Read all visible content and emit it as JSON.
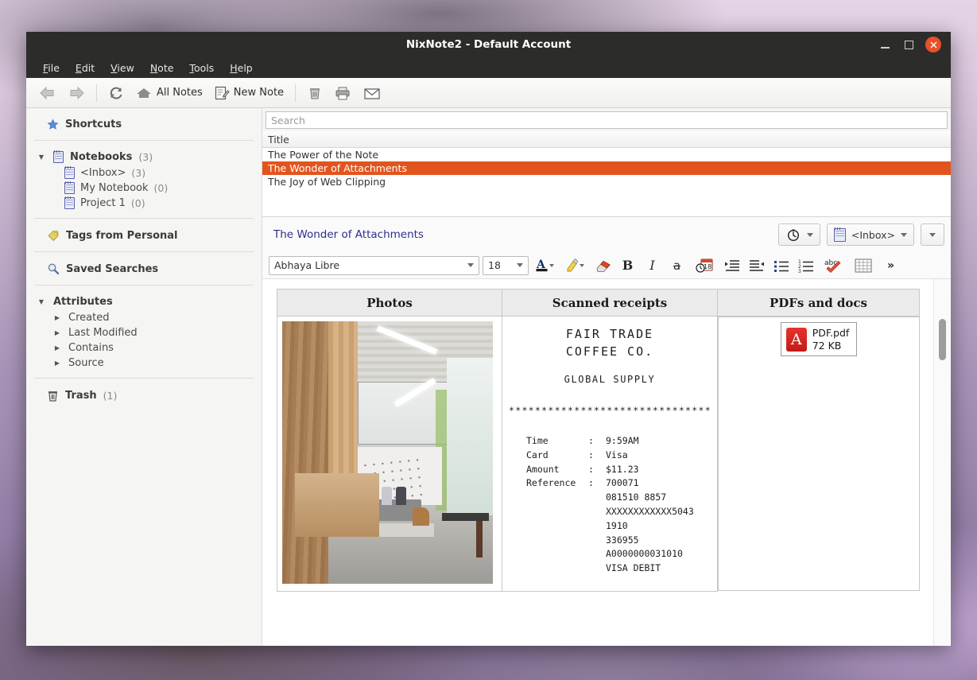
{
  "window": {
    "title": "NixNote2 - Default Account",
    "controls": {
      "minimize": "—",
      "maximize": "□",
      "close": "✕"
    },
    "close_color": "#e8502a"
  },
  "menubar": [
    {
      "label": "File",
      "accel": "F"
    },
    {
      "label": "Edit",
      "accel": "E"
    },
    {
      "label": "View",
      "accel": "V"
    },
    {
      "label": "Note",
      "accel": "N"
    },
    {
      "label": "Tools",
      "accel": "T"
    },
    {
      "label": "Help",
      "accel": "H"
    }
  ],
  "toolbar": {
    "back": "back-arrow",
    "forward": "forward-arrow",
    "sync": "sync-icon",
    "all_notes_label": "All Notes",
    "new_note_label": "New Note",
    "trash": "trash-icon",
    "print": "printer-icon",
    "email": "envelope-icon"
  },
  "sidebar": {
    "shortcuts": {
      "label": "Shortcuts",
      "icon": "star-icon"
    },
    "notebooks": {
      "label": "Notebooks",
      "count": "(3)",
      "icon": "notebook-icon",
      "items": [
        {
          "label": "<Inbox>",
          "count": "(3)"
        },
        {
          "label": "My Notebook",
          "count": "(0)"
        },
        {
          "label": "Project 1",
          "count": "(0)"
        }
      ]
    },
    "tags": {
      "label": "Tags from Personal",
      "icon": "tag-icon"
    },
    "saved_searches": {
      "label": "Saved Searches",
      "icon": "magnifier-icon"
    },
    "attributes": {
      "label": "Attributes",
      "items": [
        {
          "label": "Created"
        },
        {
          "label": "Last Modified"
        },
        {
          "label": "Contains"
        },
        {
          "label": "Source"
        }
      ]
    },
    "trash": {
      "label": "Trash",
      "count": "(1)",
      "icon": "trash-icon"
    }
  },
  "search": {
    "placeholder": "Search",
    "value": ""
  },
  "notelist": {
    "column_header": "Title",
    "selected_color": "#e2541e",
    "rows": [
      {
        "title": "The Power of the Note",
        "selected": false
      },
      {
        "title": "The Wonder of Attachments",
        "selected": true
      },
      {
        "title": "The Joy of Web Clipping",
        "selected": false
      }
    ]
  },
  "editor": {
    "note_title": "The Wonder of Attachments",
    "title_color": "#2e2e8f",
    "reminder_button": "alarm-clock-icon",
    "notebook_selector": "<Inbox>",
    "expand_button": "chevron-down-icon",
    "format_toolbar": {
      "font_family_value": "Abhaya Libre",
      "font_size_value": "18",
      "font_color": "A",
      "highlight": "highlighter-icon",
      "eraser": "eraser-icon",
      "bold": "B",
      "italic": "I",
      "strikethrough": "a",
      "todo": "todo-calendar-icon",
      "indent": "indent-icon",
      "outdent": "outdent-icon",
      "bullet_list": "bullet-list-icon",
      "numbered_list": "numbered-list-icon",
      "spellcheck": "abc",
      "table": "table-icon",
      "overflow": "»"
    }
  },
  "note_content": {
    "table_headers": [
      "Photos",
      "Scanned receipts",
      "PDFs and docs"
    ],
    "photo_alt": "office lobby photo",
    "receipt": {
      "title_line1": "FAIR TRADE",
      "title_line2": "COFFEE CO.",
      "subtitle": "GLOBAL SUPPLY",
      "separator": "*******************************",
      "fields": [
        {
          "key": "Time",
          "sep": ":",
          "value": "9:59AM"
        },
        {
          "key": "Card",
          "sep": ":",
          "value": "Visa"
        },
        {
          "key": "Amount",
          "sep": ":",
          "value": "$11.23"
        },
        {
          "key": "Reference",
          "sep": ":",
          "value": "700071"
        }
      ],
      "reference_continuation": [
        "081510 8857",
        "XXXXXXXXXXXX5043",
        "1910",
        "336955",
        "A0000000031010",
        "VISA DEBIT"
      ]
    },
    "attachment": {
      "filename": "PDF.pdf",
      "filesize": "72 KB",
      "icon": "pdf-icon"
    }
  }
}
